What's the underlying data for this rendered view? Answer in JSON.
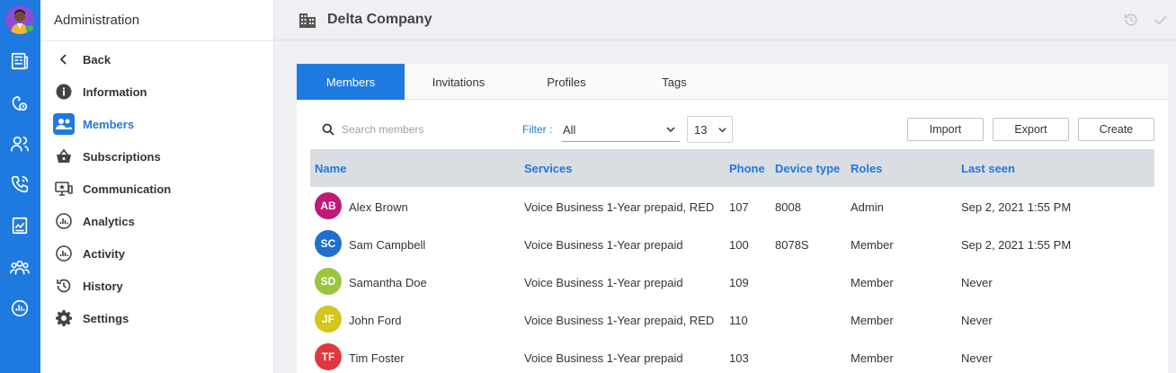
{
  "rail": {
    "icons": [
      "user-avatar",
      "news-icon",
      "phone-settings-icon",
      "users-icon",
      "phone-call-icon",
      "report-icon",
      "team-icon",
      "analytics-icon"
    ],
    "accent": "#1f7ae0",
    "online_color": "#3cc24a"
  },
  "sidebar": {
    "title": "Administration",
    "items": [
      {
        "label": "Back",
        "icon": "chevron-left-icon"
      },
      {
        "label": "Information",
        "icon": "info-icon"
      },
      {
        "label": "Members",
        "icon": "users-icon",
        "active": true
      },
      {
        "label": "Subscriptions",
        "icon": "basket-icon"
      },
      {
        "label": "Communication",
        "icon": "screen-icon"
      },
      {
        "label": "Analytics",
        "icon": "analytics-icon"
      },
      {
        "label": "Activity",
        "icon": "activity-icon"
      },
      {
        "label": "History",
        "icon": "history-icon"
      },
      {
        "label": "Settings",
        "icon": "gear-icon"
      }
    ]
  },
  "header": {
    "company_name": "Delta Company",
    "company_icon": "building-icon"
  },
  "tabs": [
    {
      "label": "Members",
      "active": true
    },
    {
      "label": "Invitations"
    },
    {
      "label": "Profiles"
    },
    {
      "label": "Tags"
    }
  ],
  "toolbar": {
    "search_placeholder": "Search members",
    "filter_label": "Filter :",
    "filter_value": "All",
    "count_value": "13",
    "import_label": "Import",
    "export_label": "Export",
    "create_label": "Create"
  },
  "table": {
    "columns": [
      "Name",
      "Services",
      "Phone",
      "Device type",
      "Roles",
      "Last seen"
    ],
    "rows": [
      {
        "initials": "AB",
        "color": "#c2187a",
        "name": "Alex Brown",
        "services": "Voice Business 1-Year prepaid, RED",
        "phone": "107",
        "device": "8008",
        "role": "Admin",
        "last_seen": "Sep 2, 2021 1:55 PM"
      },
      {
        "initials": "SC",
        "color": "#1e6fd0",
        "name": "Sam Campbell",
        "services": "Voice Business 1-Year prepaid",
        "phone": "100",
        "device": "8078S",
        "role": "Member",
        "last_seen": "Sep 2, 2021 1:55 PM"
      },
      {
        "initials": "SD",
        "color": "#9bc53d",
        "name": "Samantha Doe",
        "services": "Voice Business 1-Year prepaid",
        "phone": "109",
        "device": "",
        "role": "Member",
        "last_seen": "Never"
      },
      {
        "initials": "JF",
        "color": "#d4c51f",
        "name": "John Ford",
        "services": "Voice Business 1-Year prepaid, RED",
        "phone": "110",
        "device": "",
        "role": "Member",
        "last_seen": "Never"
      },
      {
        "initials": "TF",
        "color": "#e0383e",
        "name": "Tim Foster",
        "services": "Voice Business 1-Year prepaid",
        "phone": "103",
        "device": "",
        "role": "Member",
        "last_seen": "Never"
      }
    ]
  }
}
